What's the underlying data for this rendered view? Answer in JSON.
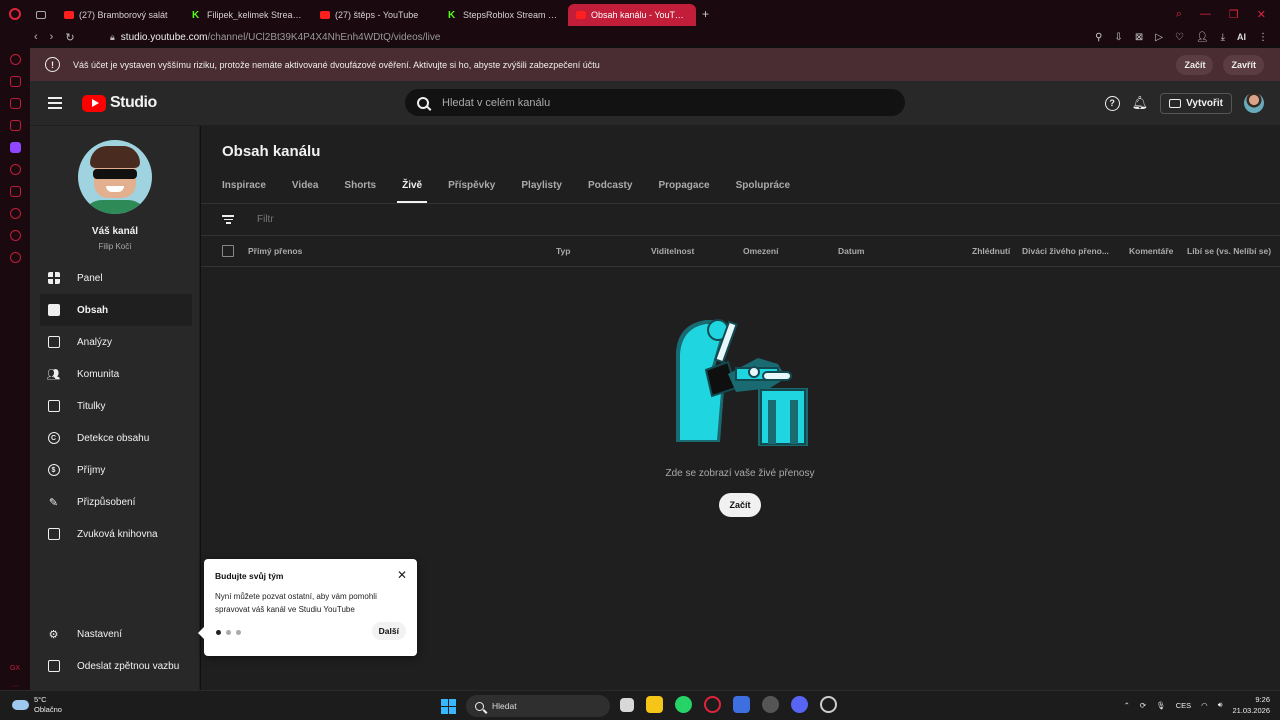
{
  "browser": {
    "tabs": [
      {
        "label": "",
        "icon": "tab-icon"
      },
      {
        "label": "(27) Bramborový salát",
        "icon": "youtube-icon"
      },
      {
        "label": "Filipek_kelimek Stream - V",
        "icon": "kick-icon"
      },
      {
        "label": "(27) štěps - YouTube",
        "icon": "youtube-icon"
      },
      {
        "label": "StepsRoblox Stream - Wal",
        "icon": "kick-icon"
      },
      {
        "label": "Obsah kanálu - YouTube S",
        "icon": "youtube-icon",
        "active": true
      }
    ],
    "url_host": "studio.youtube.com",
    "url_path": "/channel/UCl2Bt39K4P4X4NhEnh4WDtQ/videos/live",
    "ai_label": "AI"
  },
  "warning": {
    "text": "Váš účet je vystaven vyššímu riziku, protože nemáte aktivované dvoufázové ověření. Aktivujte si ho, abyste zvýšili zabezpečení účtu",
    "start_label": "Začít",
    "close_label": "Zavřít"
  },
  "header": {
    "logo_text": "Studio",
    "search_placeholder": "Hledat v celém kanálu",
    "create_label": "Vytvořit"
  },
  "channel": {
    "name": "Váš kanál",
    "handle": "Filip Kočí"
  },
  "nav": {
    "items": [
      {
        "label": "Panel",
        "icon": "dashboard-icon"
      },
      {
        "label": "Obsah",
        "icon": "content-icon",
        "active": true
      },
      {
        "label": "Analýzy",
        "icon": "analytics-icon"
      },
      {
        "label": "Komunita",
        "icon": "community-icon"
      },
      {
        "label": "Titulky",
        "icon": "subtitles-icon"
      },
      {
        "label": "Detekce obsahu",
        "icon": "copyright-icon"
      },
      {
        "label": "Příjmy",
        "icon": "earn-icon"
      },
      {
        "label": "Přizpůsobení",
        "icon": "customization-icon"
      },
      {
        "label": "Zvuková knihovna",
        "icon": "audio-library-icon"
      }
    ],
    "settings_label": "Nastavení",
    "feedback_label": "Odeslat zpětnou vazbu"
  },
  "main": {
    "title": "Obsah kanálu",
    "tabs": [
      "Inspirace",
      "Videa",
      "Shorts",
      "Živě",
      "Příspěvky",
      "Playlisty",
      "Podcasty",
      "Propagace",
      "Spolupráce"
    ],
    "active_tab": "Živě",
    "filter_placeholder": "Filtr",
    "columns": [
      "Přímý přenos",
      "Typ",
      "Viditelnost",
      "Omezení",
      "Datum",
      "Zhlédnutí",
      "Diváci živého přeno...",
      "Komentáře",
      "Líbí se (vs. Nelíbí se)"
    ],
    "empty_text": "Zde se zobrazí vaše živé přenosy",
    "start_button": "Začít"
  },
  "popup": {
    "title": "Budujte svůj tým",
    "body": "Nyní můžete pozvat ostatní, aby vám pomohli spravovat váš kanál ve Studiu YouTube",
    "next_label": "Další",
    "step": 1,
    "steps": 3
  },
  "taskbar": {
    "temperature": "5°C",
    "weather": "Oblačno",
    "search_label": "Hledat",
    "language": "CES",
    "time": "9:26",
    "date": "21.03.2026"
  },
  "colors": {
    "accent": "#c21d39",
    "youtube_red": "#ff0000",
    "illustration": "#1fd5e0"
  }
}
